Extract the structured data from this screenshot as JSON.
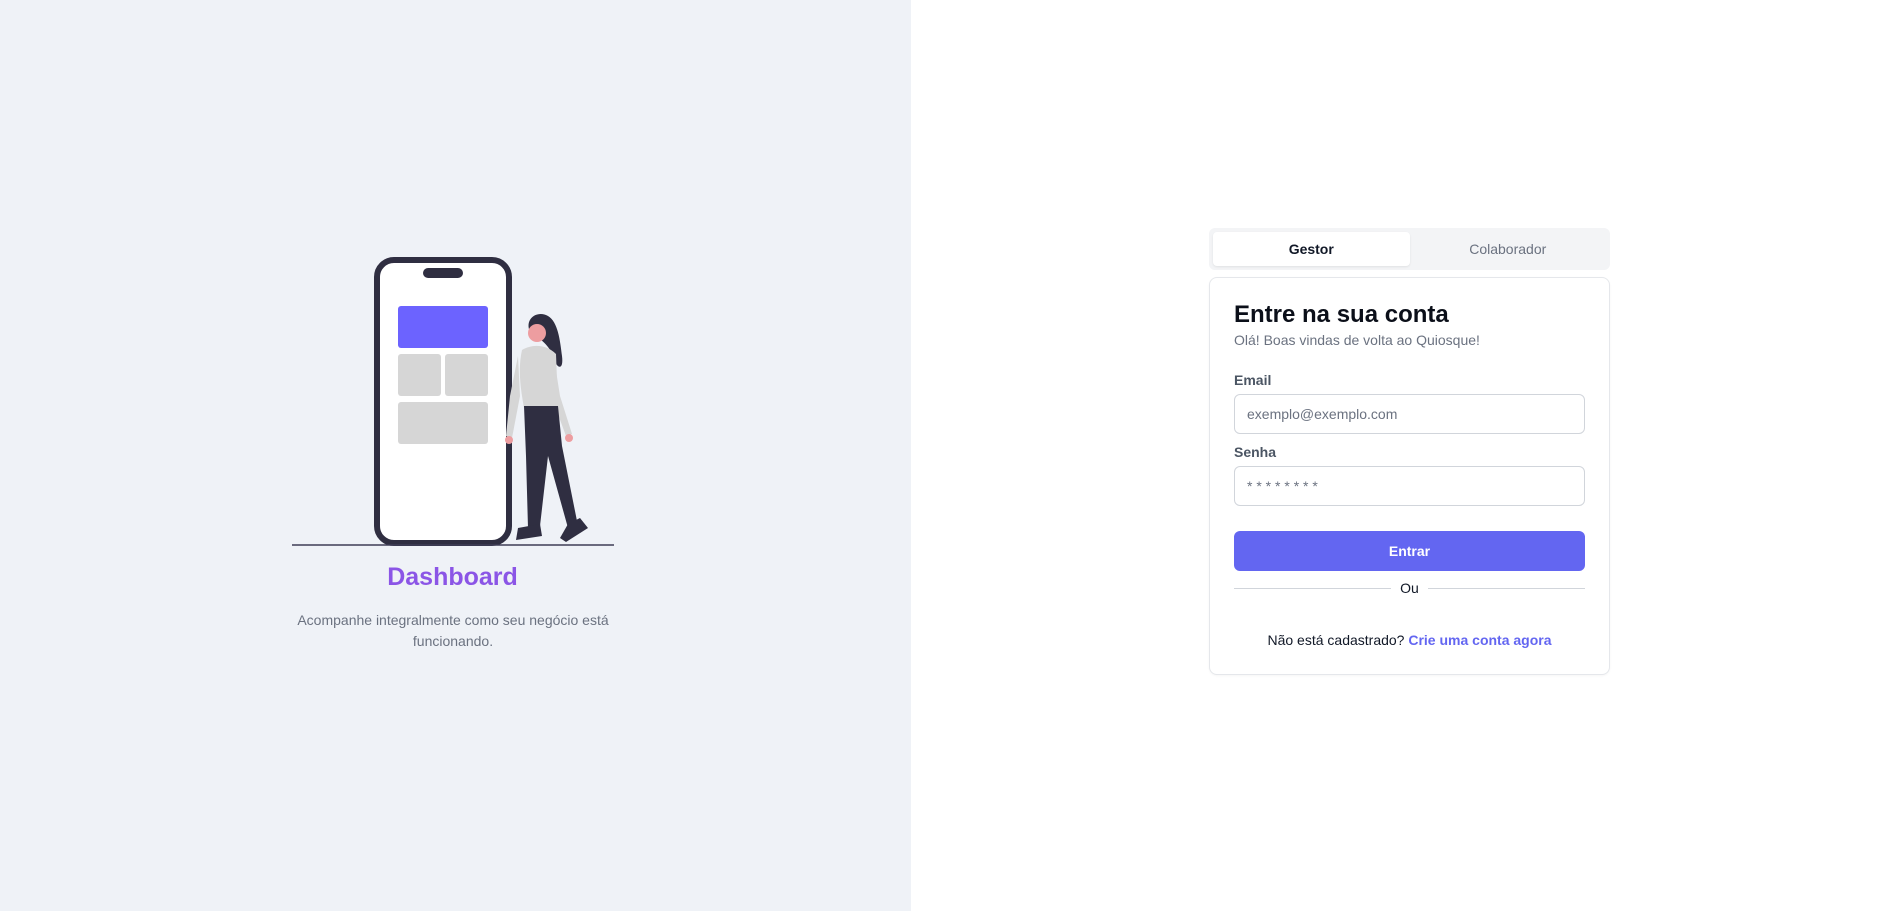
{
  "hero": {
    "title": "Dashboard",
    "description": "Acompanhe integralmente como seu negócio está funcionando."
  },
  "tabs": [
    {
      "label": "Gestor",
      "active": true
    },
    {
      "label": "Colaborador",
      "active": false
    }
  ],
  "login": {
    "title": "Entre na sua conta",
    "subtitle": "Olá! Boas vindas de volta ao Quiosque!",
    "email_label": "Email",
    "email_placeholder": "exemplo@exemplo.com",
    "password_label": "Senha",
    "password_placeholder": "* * * * * * * *",
    "submit_label": "Entrar",
    "divider_text": "Ou",
    "signup_prompt": "Não está cadastrado?",
    "signup_link": "Crie uma conta agora"
  },
  "colors": {
    "left_background": "#eff2f7",
    "accent": "#6366f1",
    "hero_title": "#8b55e6"
  }
}
